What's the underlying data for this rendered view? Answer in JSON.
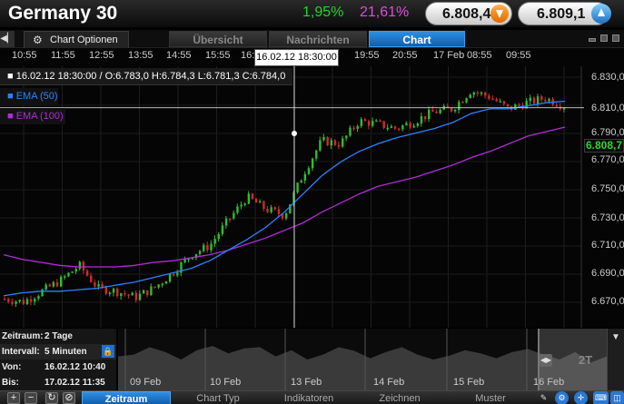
{
  "header": {
    "instrument": "Germany 30",
    "change_pct_1": "1,95%",
    "change_pct_2": "21,61%",
    "bid_price": "6.808,4",
    "ask_price": "6.809,1"
  },
  "tabbar": {
    "chart_options_label": "Chart Optionen",
    "tabs": [
      {
        "label": "Übersicht",
        "active": false
      },
      {
        "label": "Nachrichten",
        "active": false
      },
      {
        "label": "Chart",
        "active": true
      }
    ]
  },
  "chart": {
    "time_labels": [
      "10:55",
      "11:55",
      "12:55",
      "13:55",
      "14:55",
      "15:55",
      "16:",
      "19:55",
      "20:55",
      "17 Feb",
      "08:55",
      "09:55"
    ],
    "cursor_time": "16.02.12 18:30:00",
    "ohlc_text": "16.02.12 18:30:00 / O:6.783,0  H:6.784,3  L:6.781,3  C:6.784,0",
    "legend": [
      {
        "label": "EMA (50)",
        "color": "#2a82ff"
      },
      {
        "label": "EMA (100)",
        "color": "#b02cd8"
      }
    ],
    "current_price_label": "6.808,7",
    "colors": {
      "up": "#2fbd2f",
      "down": "#d02a2a",
      "ema50": "#2a82ff",
      "ema100": "#b02cd8"
    }
  },
  "chart_data": {
    "type": "line",
    "y_axis_labels": [
      "6.830,00",
      "6.810,00",
      "6.790,00",
      "6.770,00",
      "6.750,00",
      "6.730,00",
      "6.710,00",
      "6.690,00",
      "6.670,00"
    ],
    "ylim": [
      6664,
      6836
    ],
    "price_path": [
      6683,
      6681,
      6688,
      6695,
      6705,
      6690,
      6688,
      6684,
      6690,
      6700,
      6712,
      6718,
      6735,
      6750,
      6742,
      6738,
      6765,
      6787,
      6785,
      6800,
      6798,
      6795,
      6800,
      6806,
      6808,
      6820,
      6816,
      6808,
      6812,
      6815,
      6810
    ],
    "ema50": [
      6685,
      6687,
      6688,
      6688,
      6689,
      6690,
      6692,
      6694,
      6697,
      6700,
      6703,
      6708,
      6715,
      6722,
      6730,
      6740,
      6752,
      6764,
      6773,
      6780,
      6785,
      6789,
      6792,
      6795,
      6799,
      6805,
      6808,
      6808,
      6810,
      6812,
      6813
    ],
    "ema100": [
      6712,
      6709,
      6707,
      6705,
      6704,
      6704,
      6704,
      6705,
      6707,
      6708,
      6710,
      6712,
      6715,
      6719,
      6723,
      6728,
      6733,
      6740,
      6746,
      6752,
      6757,
      6760,
      6763,
      6767,
      6771,
      6776,
      6780,
      6785,
      6790,
      6793,
      6796
    ],
    "current_price": 6808.7
  },
  "navigator": {
    "dates": [
      "09 Feb",
      "10 Feb",
      "13 Feb",
      "14 Feb",
      "15 Feb",
      "16 Feb"
    ],
    "selection_label": "2T",
    "profile": [
      0.45,
      0.42,
      0.3,
      0.38,
      0.5,
      0.35,
      0.28,
      0.4,
      0.32,
      0.3,
      0.45,
      0.35,
      0.5,
      0.42,
      0.3,
      0.36,
      0.48,
      0.38,
      0.3,
      0.42,
      0.5,
      0.44,
      0.35,
      0.4,
      0.48,
      0.38,
      0.33,
      0.42,
      0.5,
      0.38,
      0.55,
      0.45
    ]
  },
  "info": {
    "zeitraum_key": "Zeitraum:",
    "zeitraum_value": "2 Tage",
    "intervall_key": "Intervall:",
    "intervall_value": "5 Minuten",
    "von_key": "Von:",
    "von_value": "16.02.12 10:40",
    "bis_key": "Bis:",
    "bis_value": "17.02.12 11:35"
  },
  "toolbar": {
    "tabs": [
      {
        "label": "Zeitraum",
        "active": true
      },
      {
        "label": "Chart Typ",
        "active": false
      },
      {
        "label": "Indikatoren",
        "active": false
      },
      {
        "label": "Zeichnen",
        "active": false
      },
      {
        "label": "Muster",
        "active": false
      }
    ]
  }
}
